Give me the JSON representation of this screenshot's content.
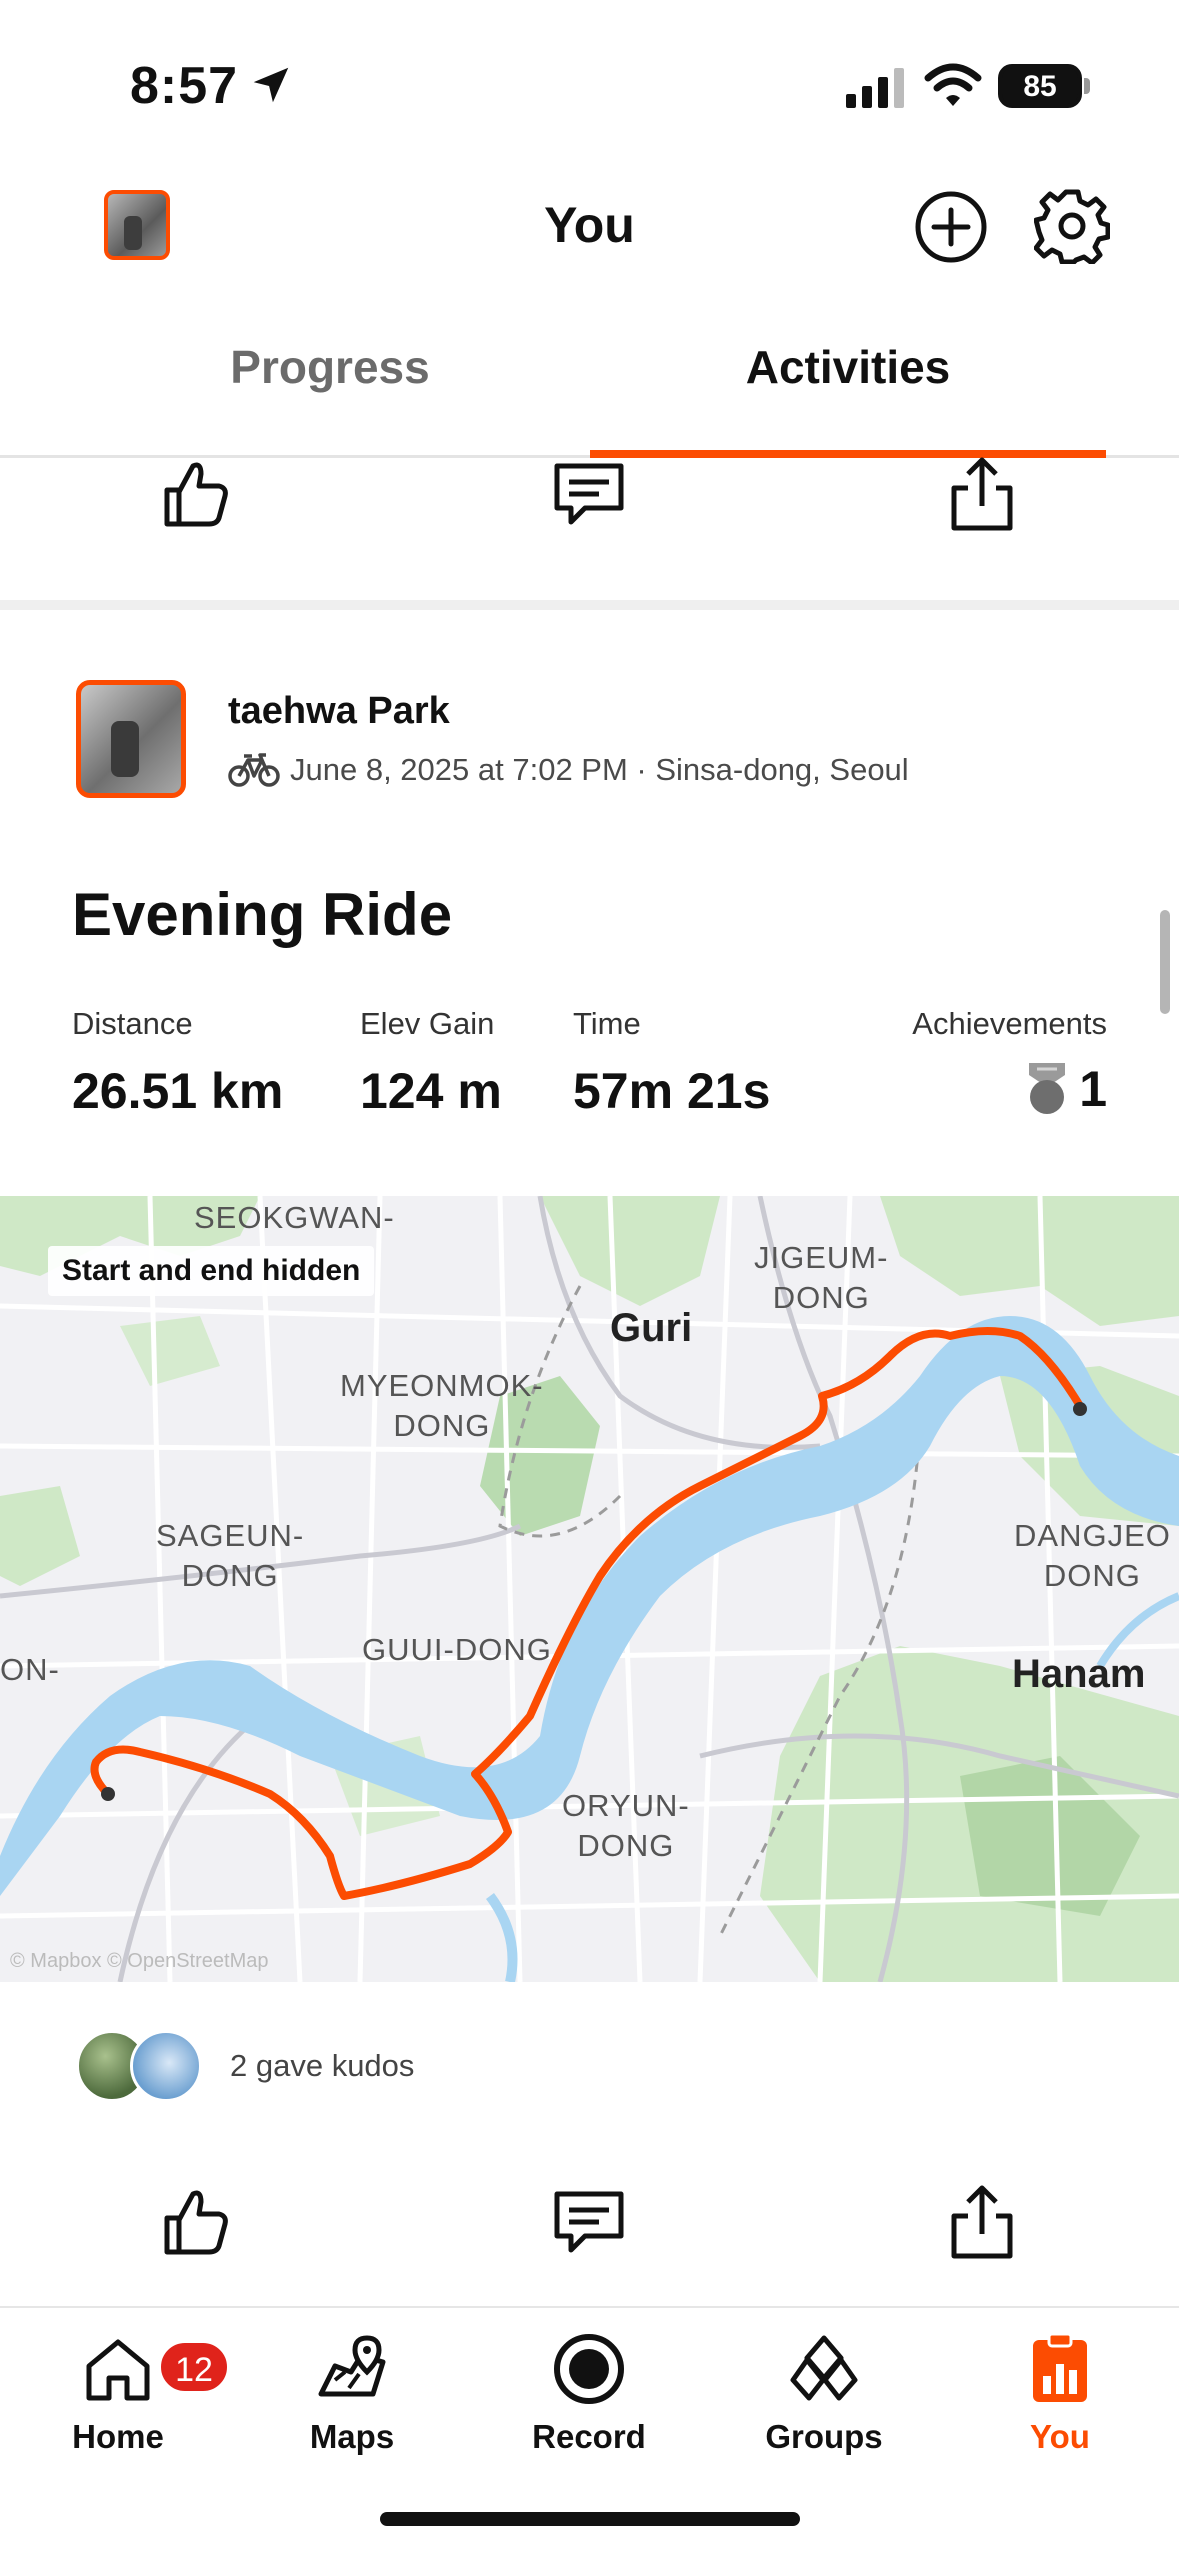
{
  "status_bar": {
    "time": "8:57",
    "battery": "85"
  },
  "header": {
    "title": "You"
  },
  "tabs": [
    {
      "label": "Progress"
    },
    {
      "label": "Activities"
    }
  ],
  "activity": {
    "athlete_name": "taehwa Park",
    "meta": "June 8, 2025 at 7:02 PM · Sinsa-dong, Seoul",
    "title": "Evening Ride",
    "stats": {
      "distance_label": "Distance",
      "distance_value": "26.51 km",
      "elev_label": "Elev Gain",
      "elev_value": "124 m",
      "time_label": "Time",
      "time_value": "57m 21s",
      "achievements_label": "Achievements",
      "achievements_value": "1"
    },
    "map": {
      "badge": "Start and end hidden",
      "labels": {
        "seokgwan": "SEOKGWAN-",
        "jigeum": "JIGEUM-\nDONG",
        "guri": "Guri",
        "myeonmok": "MYEONMOK-\nDONG",
        "sageun": "SAGEUN-\nDONG",
        "dangjeong": "DANGJEO\nDONG",
        "guui": "GUUI-DONG",
        "hanam": "Hanam",
        "on": "ON-",
        "oryun": "ORYUN-\nDONG"
      },
      "attribution": "© Mapbox © OpenStreetMap"
    },
    "kudos_text": "2 gave kudos"
  },
  "tabbar": {
    "home": "Home",
    "home_badge": "12",
    "maps": "Maps",
    "record": "Record",
    "groups": "Groups",
    "you": "You"
  },
  "colors": {
    "accent": "#fc4c02",
    "badge": "#e0231b",
    "river": "#a9d5f2",
    "park": "#cfe8c6"
  }
}
